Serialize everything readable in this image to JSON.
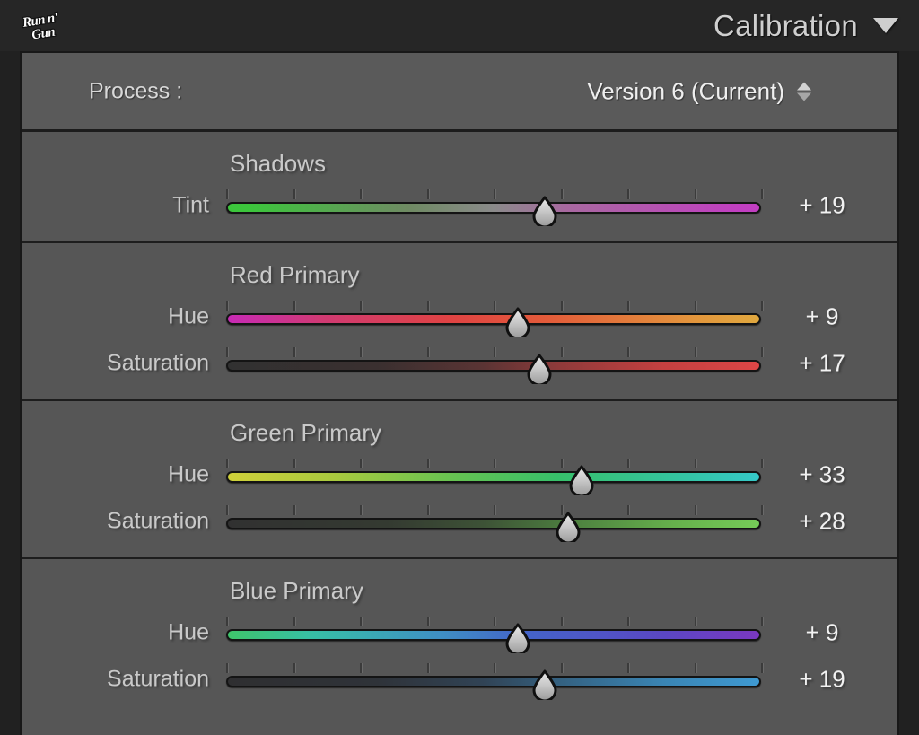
{
  "header": {
    "logo_line1": "Run n'",
    "logo_line2": "Gun",
    "logo_name": "run-n-gun-logo",
    "title": "Calibration",
    "collapse_icon": "triangle-down-icon"
  },
  "process": {
    "label": "Process :",
    "value": "Version 6 (Current)",
    "stepper_icon": "up-down-stepper-icon"
  },
  "groups": [
    {
      "title": "Shadows",
      "key": "shadows",
      "sliders": [
        {
          "label": "Tint",
          "value": "+ 19",
          "amount": 19,
          "min": -100,
          "max": 100,
          "gradient": "linear-gradient(to right, #3cc63c 0%, #3cc63c 4%, #6f8a63 34%, #8a8a8a 50%, #a868a0 64%, #c13fc1 96%, #c13fc1 100%)"
        }
      ]
    },
    {
      "title": "Red Primary",
      "key": "red_primary",
      "sliders": [
        {
          "label": "Hue",
          "value": "+ 9",
          "amount": 9,
          "min": -100,
          "max": 100,
          "gradient": "linear-gradient(to right, #c72ab5 0%, #d03a72 18%, #e04343 42%, #e35b3a 60%, #e3963c 88%, #e0a83f 100%)"
        },
        {
          "label": "Saturation",
          "value": "+ 17",
          "amount": 17,
          "min": -100,
          "max": 100,
          "gradient": "linear-gradient(to right, #313131 0%, #3a3030 28%, #5a3434 48%, #8e3a3a 62%, #c54040 82%, #dc4646 100%)"
        }
      ]
    },
    {
      "title": "Green Primary",
      "key": "green_primary",
      "sliders": [
        {
          "label": "Hue",
          "value": "+ 33",
          "amount": 33,
          "min": -100,
          "max": 100,
          "gradient": "linear-gradient(to right, #cfd03a 0%, #a9c93e 20%, #62c253 44%, #37c06a 62%, #34c4a4 86%, #35c8c8 100%)"
        },
        {
          "label": "Saturation",
          "value": "+ 28",
          "amount": 28,
          "min": -100,
          "max": 100,
          "gradient": "linear-gradient(to right, #313131 0%, #343a31 30%, #3d5236 48%, #4c7e3f 64%, #66b14c 84%, #76cc58 100%)"
        }
      ]
    },
    {
      "title": "Blue Primary",
      "key": "blue_primary",
      "sliders": [
        {
          "label": "Hue",
          "value": "+ 9",
          "amount": 9,
          "min": -100,
          "max": 100,
          "gradient": "linear-gradient(to right, #3fc46b 0%, #37bfa6 16%, #3f8fc4 40%, #4464c9 56%, #5a47c3 82%, #7a38c0 100%)"
        },
        {
          "label": "Saturation",
          "value": "+ 19",
          "amount": 19,
          "min": -100,
          "max": 100,
          "gradient": "linear-gradient(to right, #2f2f31 0%, #2f3339 28%, #314355 48%, #34607f 62%, #3a85b4 82%, #3f9ad2 100%)"
        }
      ]
    }
  ],
  "colors": {
    "panel_bg": "#565656",
    "header_bg": "#262626",
    "outer_bg": "#212121",
    "text": "#c9c9c9",
    "value_text": "#f2f2f2",
    "border": "#181818"
  }
}
